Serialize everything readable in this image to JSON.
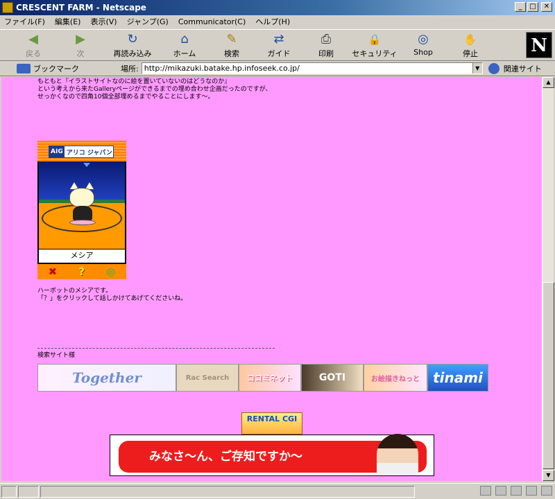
{
  "window": {
    "title": "CRESCENT FARM - Netscape",
    "controls": {
      "minimize": "_",
      "maximize": "□",
      "close": "✕"
    }
  },
  "menu": [
    "ファイル(F)",
    "編集(E)",
    "表示(V)",
    "ジャンプ(G)",
    "Communicator(C)",
    "ヘルプ(H)"
  ],
  "toolbar": [
    {
      "label": "戻る",
      "icon": "back-arrow-icon",
      "glyph": "◀",
      "enabled": false
    },
    {
      "label": "次",
      "icon": "forward-arrow-icon",
      "glyph": "▶",
      "enabled": false
    },
    {
      "label": "再読み込み",
      "icon": "reload-icon",
      "glyph": "↻",
      "enabled": true
    },
    {
      "label": "ホーム",
      "icon": "home-icon",
      "glyph": "⌂",
      "enabled": true
    },
    {
      "label": "検索",
      "icon": "search-icon",
      "glyph": "✎",
      "enabled": true
    },
    {
      "label": "ガイド",
      "icon": "guide-icon",
      "glyph": "⇄",
      "enabled": true
    },
    {
      "label": "印刷",
      "icon": "print-icon",
      "glyph": "⎙",
      "enabled": true
    },
    {
      "label": "セキュリティ",
      "icon": "security-lock-icon",
      "glyph": "🔒",
      "enabled": true
    },
    {
      "label": "Shop",
      "icon": "shop-icon",
      "glyph": "◎",
      "enabled": true
    },
    {
      "label": "停止",
      "icon": "stop-icon",
      "glyph": "✋",
      "enabled": true
    }
  ],
  "logo": "N",
  "location": {
    "bookmark_label": "ブックマーク",
    "place_label": "場所:",
    "url": "http://mikazuki.batake.hp.infoseek.co.jp/",
    "related_label": "関連サイト"
  },
  "content": {
    "intro_lines": [
      "もともと『イラストサイトなのに絵を置いていないのはどうなのか』",
      "という考えから来たGalleryページができるまでの埋め合わせ企画だったのですが、",
      "せっかくなので四角10個全部埋めるまでやることにします〜。"
    ],
    "harbot": {
      "sponsor_logo": "AIG",
      "sponsor_name": "アリコ ジャパン",
      "character_name": "メシア",
      "controls": [
        "✖",
        "?",
        "◎"
      ]
    },
    "harbot_desc_lines": [
      "ハーボットのメシアです。",
      "「？」をクリックして話しかけてあげてくださいね。"
    ],
    "search_sites_label": "検索サイト様",
    "banners": [
      {
        "text": "Together"
      },
      {
        "text": "Rac Search"
      },
      {
        "text": "ココミネット"
      },
      {
        "text": "GOTI"
      },
      {
        "text": "お絵描きねっと"
      },
      {
        "text": "tinami"
      }
    ],
    "rental_banner": "RENTAL CGI",
    "ad_text": "みなさ〜ん、ご存知ですか〜"
  },
  "colors": {
    "page_background": "#ff99ff",
    "ad_red": "#ee1d1d"
  }
}
